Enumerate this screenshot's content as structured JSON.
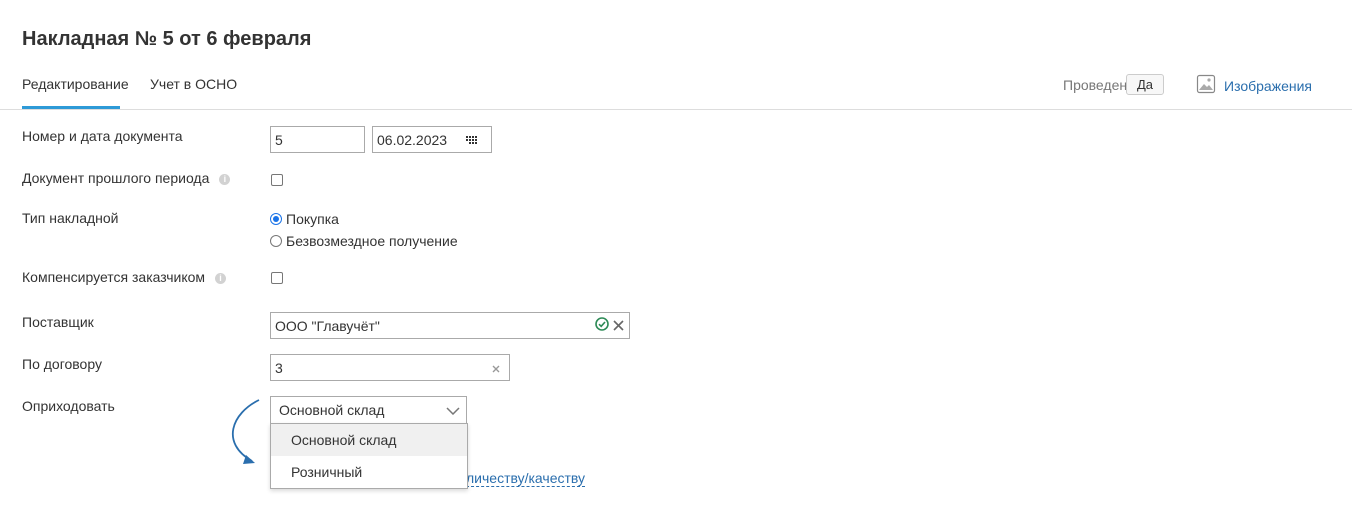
{
  "header": {
    "title": "Накладная № 5 от 6 февраля"
  },
  "tabs": [
    {
      "label": "Редактирование",
      "active": true
    },
    {
      "label": "Учет в ОСНО",
      "active": false
    }
  ],
  "status": {
    "posted_label": "Проведен",
    "posted_value": "Да"
  },
  "images": {
    "label": "Изображения",
    "icon": "image-icon"
  },
  "form": {
    "doc_number": {
      "label": "Номер и дата документа",
      "number": "5",
      "date": "06.02.2023",
      "icon": "calendar-icon"
    },
    "prev_period": {
      "label": "Документ прошлого периода",
      "checked": false,
      "info_icon": "i"
    },
    "invoice_type": {
      "label": "Тип накладной",
      "options": [
        "Покупка",
        "Безвозмездное получение"
      ],
      "selected": "Покупка"
    },
    "compensated": {
      "label": "Компенсируется заказчиком",
      "checked": false,
      "info_icon": "i"
    },
    "supplier": {
      "label": "Поставщик",
      "value": "ООО \"Главучёт\""
    },
    "contract": {
      "label": "По договору",
      "value": "3"
    },
    "warehouse": {
      "label": "Оприходовать",
      "selected": "Основной склад",
      "options": [
        "Основной склад",
        "Розничный"
      ],
      "hovered": "Основной склад"
    },
    "discrepancy_link": "личеству/качеству"
  },
  "colors": {
    "accent": "#2e9ad7",
    "link": "#2a6ead",
    "check_ok": "#2e8b57",
    "arrow": "#2a6ead"
  }
}
